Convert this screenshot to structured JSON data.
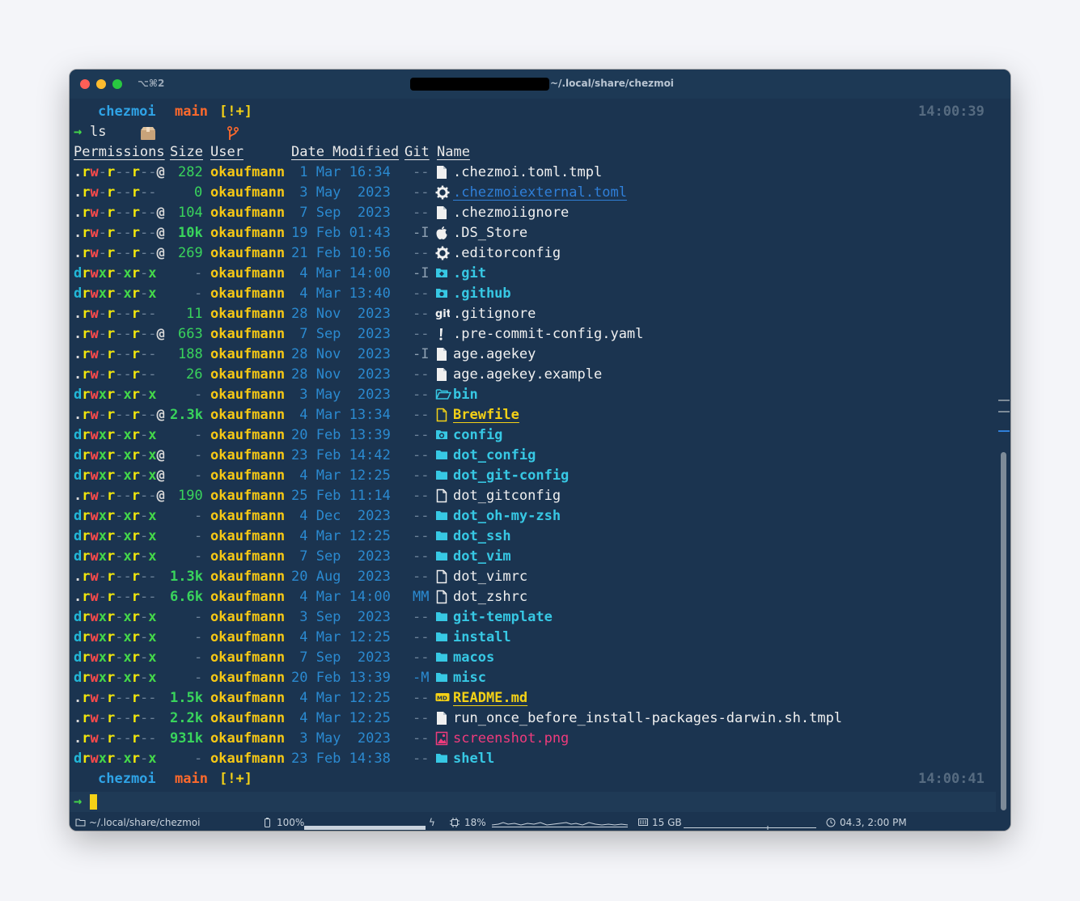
{
  "window": {
    "shortcut": "⌥⌘2",
    "path": "~/.local/share/chezmoi"
  },
  "prompt1": {
    "dir": "chezmoi",
    "branch": "main",
    "status": "[!+]",
    "time": "14:00:39"
  },
  "command": "ls",
  "headers": {
    "perms": "Permissions",
    "size": "Size",
    "user": "User",
    "date": "Date Modified",
    "git": "Git",
    "name": "Name"
  },
  "files": [
    {
      "p": ".rw-r--r--@",
      "size": "282",
      "user": "okaufmann",
      "date": " 1 Mar 16:34",
      "git": "--",
      "icon": "file-icon",
      "name": ".chezmoi.toml.tmpl",
      "kind": "file"
    },
    {
      "p": ".rw-r--r--",
      "size": "0",
      "user": "okaufmann",
      "date": " 3 May  2023",
      "git": "--",
      "icon": "gear-icon",
      "name": ".chezmoiexternal.toml",
      "kind": "link"
    },
    {
      "p": ".rw-r--r--@",
      "size": "104",
      "user": "okaufmann",
      "date": " 7 Sep  2023",
      "git": "--",
      "icon": "file-icon",
      "name": ".chezmoiignore",
      "kind": "file"
    },
    {
      "p": ".rw-r--r--@",
      "size": "10k",
      "user": "okaufmann",
      "date": "19 Feb 01:43",
      "git": "-I",
      "icon": "apple-icon",
      "name": ".DS_Store",
      "kind": "file"
    },
    {
      "p": ".rw-r--r--@",
      "size": "269",
      "user": "okaufmann",
      "date": "21 Feb 10:56",
      "git": "--",
      "icon": "gear-icon",
      "name": ".editorconfig",
      "kind": "file"
    },
    {
      "p": "drwxr-xr-x",
      "size": "-",
      "user": "okaufmann",
      "date": " 4 Mar 14:00",
      "git": "-I",
      "icon": "git-folder-icon",
      "name": ".git",
      "kind": "dir"
    },
    {
      "p": "drwxr-xr-x",
      "size": "-",
      "user": "okaufmann",
      "date": " 4 Mar 13:40",
      "git": "--",
      "icon": "github-folder-icon",
      "name": ".github",
      "kind": "dir"
    },
    {
      "p": ".rw-r--r--",
      "size": "11",
      "user": "okaufmann",
      "date": "28 Nov  2023",
      "git": "--",
      "icon": "git-icon",
      "name": ".gitignore",
      "kind": "file"
    },
    {
      "p": ".rw-r--r--@",
      "size": "663",
      "user": "okaufmann",
      "date": " 7 Sep  2023",
      "git": "--",
      "icon": "exclamation-icon",
      "name": ".pre-commit-config.yaml",
      "kind": "file"
    },
    {
      "p": ".rw-r--r--",
      "size": "188",
      "user": "okaufmann",
      "date": "28 Nov  2023",
      "git": "-I",
      "icon": "file-icon",
      "name": "age.agekey",
      "kind": "file"
    },
    {
      "p": ".rw-r--r--",
      "size": "26",
      "user": "okaufmann",
      "date": "28 Nov  2023",
      "git": "--",
      "icon": "file-icon",
      "name": "age.agekey.example",
      "kind": "file"
    },
    {
      "p": "drwxr-xr-x",
      "size": "-",
      "user": "okaufmann",
      "date": " 3 May  2023",
      "git": "--",
      "icon": "open-folder-icon",
      "name": "bin",
      "kind": "dir"
    },
    {
      "p": ".rw-r--r--@",
      "size": "2.3k",
      "user": "okaufmann",
      "date": " 4 Mar 13:34",
      "git": "--",
      "icon": "file-outline-yellow-icon",
      "name": "Brewfile",
      "kind": "yellow"
    },
    {
      "p": "drwxr-xr-x",
      "size": "-",
      "user": "okaufmann",
      "date": "20 Feb 13:39",
      "git": "--",
      "icon": "config-folder-icon",
      "name": "config",
      "kind": "dir"
    },
    {
      "p": "drwxr-xr-x@",
      "size": "-",
      "user": "okaufmann",
      "date": "23 Feb 14:42",
      "git": "--",
      "icon": "folder-icon",
      "name": "dot_config",
      "kind": "dir"
    },
    {
      "p": "drwxr-xr-x@",
      "size": "-",
      "user": "okaufmann",
      "date": " 4 Mar 12:25",
      "git": "--",
      "icon": "folder-icon",
      "name": "dot_git-config",
      "kind": "dir"
    },
    {
      "p": ".rw-r--r--@",
      "size": "190",
      "user": "okaufmann",
      "date": "25 Feb 11:14",
      "git": "--",
      "icon": "file-outline-icon",
      "name": "dot_gitconfig",
      "kind": "file"
    },
    {
      "p": "drwxr-xr-x",
      "size": "-",
      "user": "okaufmann",
      "date": " 4 Dec  2023",
      "git": "--",
      "icon": "folder-icon",
      "name": "dot_oh-my-zsh",
      "kind": "dir"
    },
    {
      "p": "drwxr-xr-x",
      "size": "-",
      "user": "okaufmann",
      "date": " 4 Mar 12:25",
      "git": "--",
      "icon": "folder-icon",
      "name": "dot_ssh",
      "kind": "dir"
    },
    {
      "p": "drwxr-xr-x",
      "size": "-",
      "user": "okaufmann",
      "date": " 7 Sep  2023",
      "git": "--",
      "icon": "folder-icon",
      "name": "dot_vim",
      "kind": "dir"
    },
    {
      "p": ".rw-r--r--",
      "size": "1.3k",
      "user": "okaufmann",
      "date": "20 Aug  2023",
      "git": "--",
      "icon": "file-outline-icon",
      "name": "dot_vimrc",
      "kind": "file"
    },
    {
      "p": ".rw-r--r--",
      "size": "6.6k",
      "user": "okaufmann",
      "date": " 4 Mar 14:00",
      "git": "MM",
      "icon": "file-outline-icon",
      "name": "dot_zshrc",
      "kind": "file"
    },
    {
      "p": "drwxr-xr-x",
      "size": "-",
      "user": "okaufmann",
      "date": " 3 Sep  2023",
      "git": "--",
      "icon": "folder-icon",
      "name": "git-template",
      "kind": "dir"
    },
    {
      "p": "drwxr-xr-x",
      "size": "-",
      "user": "okaufmann",
      "date": " 4 Mar 12:25",
      "git": "--",
      "icon": "folder-icon",
      "name": "install",
      "kind": "dir"
    },
    {
      "p": "drwxr-xr-x",
      "size": "-",
      "user": "okaufmann",
      "date": " 7 Sep  2023",
      "git": "--",
      "icon": "folder-icon",
      "name": "macos",
      "kind": "dir"
    },
    {
      "p": "drwxr-xr-x",
      "size": "-",
      "user": "okaufmann",
      "date": "20 Feb 13:39",
      "git": "-M",
      "icon": "folder-icon",
      "name": "misc",
      "kind": "dir"
    },
    {
      "p": ".rw-r--r--",
      "size": "1.5k",
      "user": "okaufmann",
      "date": " 4 Mar 12:25",
      "git": "--",
      "icon": "markdown-icon",
      "name": "README.md",
      "kind": "yellow"
    },
    {
      "p": ".rw-r--r--",
      "size": "2.2k",
      "user": "okaufmann",
      "date": " 4 Mar 12:25",
      "git": "--",
      "icon": "file-icon",
      "name": "run_once_before_install-packages-darwin.sh.tmpl",
      "kind": "file"
    },
    {
      "p": ".rw-r--r--",
      "size": "931k",
      "user": "okaufmann",
      "date": " 3 May  2023",
      "git": "--",
      "icon": "image-icon",
      "name": "screenshot.png",
      "kind": "image"
    },
    {
      "p": "drwxr-xr-x",
      "size": "-",
      "user": "okaufmann",
      "date": "23 Feb 14:38",
      "git": "--",
      "icon": "folder-icon",
      "name": "shell",
      "kind": "dir"
    }
  ],
  "prompt2": {
    "dir": "chezmoi",
    "branch": "main",
    "status": "[!+]",
    "time": "14:00:41"
  },
  "statusbar": {
    "path": "~/.local/share/chezmoi",
    "battery": "100%",
    "cpu": "18%",
    "memory": "15 GB",
    "clock": "04.3, 2:00 PM"
  },
  "colors": {
    "background": "#1b3450",
    "directory": "#37c8e4",
    "user": "#f6c815",
    "size": "#39d45c",
    "date": "#2b8ad0",
    "branch": "#ff6a2c"
  }
}
